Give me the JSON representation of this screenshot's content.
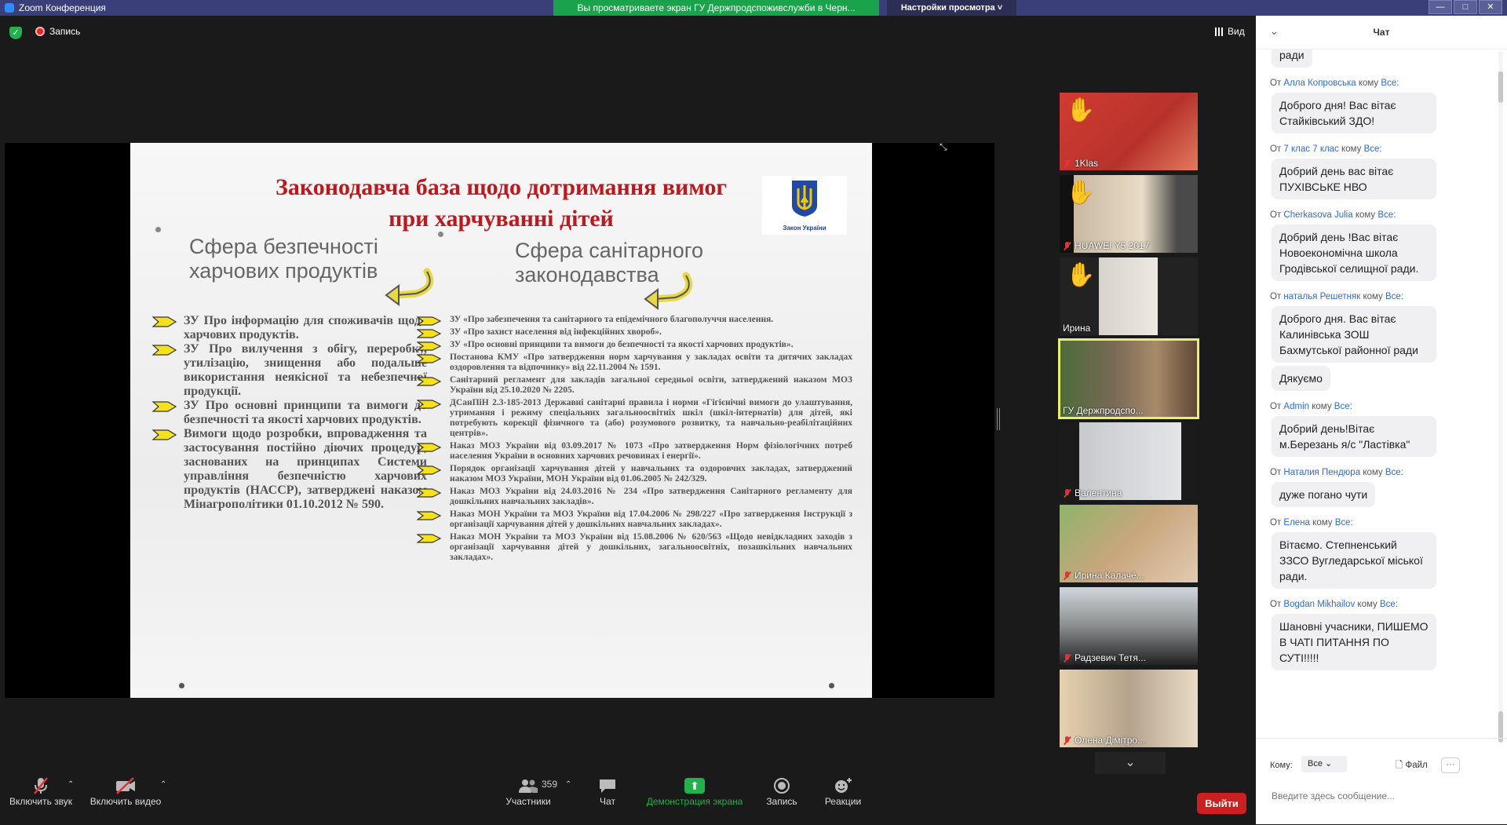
{
  "window": {
    "app_title": "Zoom Конференция",
    "share_banner": "Вы просматриваете экран ГУ Держпродспоживслужби в Черн...",
    "view_settings": "Настройки просмотра",
    "controls": [
      "—",
      "□",
      "✕"
    ]
  },
  "meeting_top": {
    "recording_label": "Запись",
    "view_label": "Вид"
  },
  "slide": {
    "title_line1": "Законодавча база щодо дотримання вимог",
    "title_line2": "при харчуванні дітей",
    "emblem_caption": "Закон України",
    "sphere_left": "Сфера безпечності харчових продуктів",
    "sphere_right": "Сфера санітарного законодавства",
    "left_items": [
      "ЗУ Про інформацію для споживачів щодо харчових продуктів.",
      "ЗУ Про вилучення з обігу, переробку, утилізацію, знищення або подальше використання неякісної та небезпечної продукції.",
      "ЗУ Про основні принципи та вимоги до безпечності та якості харчових продуктів.",
      "Вимоги щодо розробки, впровадження та застосування постійно діючих процедур, заснованих на принципах Системи управління безпечністю харчових продуктів (НАССР), затверджені наказом Мінагрополітики 01.10.2012 № 590."
    ],
    "right_items": [
      "ЗУ «Про забезпечення та санітарного та епідемічного благополуччя населення.",
      "ЗУ «Про захист населення від інфекційних хвороб».",
      "ЗУ «Про основні принципи та вимоги до безпечності та якості харчових продуктів».",
      "Постанова КМУ «Про затвердження норм харчування у закладах освіти та дитячих закладах оздоровлення та відпочинку» від 22.11.2004 № 1591.",
      "Санітарний регламент для закладів загальної середньої освіти, затверджений наказом МОЗ України від 25.10.2020 № 2205.",
      "ДСанПіН 2.3-185-2013 Державні санітарні правила і норми «Гігієнічні вимоги до улаштування, утримання і режиму спеціальних загальноосвітніх шкіл (шкіл-інтернатів) для дітей, які потребують корекції фізичного та (або) розумового розвитку, та навчально-реабілітаційних центрів».",
      "Наказ МОЗ України від 03.09.2017 № 1073 «Про затвердження Норм фізіологічних потреб населення України в основних харчових речовинах і енергії».",
      "Порядок організації харчування дітей у навчальних та оздоровчих закладах, затверджений наказом МОЗ України, МОН України від 01.06.2005 № 242/329.",
      "Наказ МОЗ України від 24.03.2016 № 234 «Про затвердження Санітарного регламенту для дошкільних навчальних закладів».",
      "Наказ МОН України та МОЗ України від 17.04.2006 № 298/227 «Про затвердження Інструкції з організації харчування дітей у дошкільних навчальних закладах».",
      "Наказ МОН України та МОЗ України від 15.08.2006 № 620/563 «Щодо невідкладних заходів з організації харчування дітей у дошкільних, загальноосвітніх, позашкільних навчальних закладах»."
    ]
  },
  "participants": [
    {
      "name": "1Klas",
      "muted": true,
      "hand": true
    },
    {
      "name": "HUAWEI Y5 2017",
      "muted": true,
      "hand": true
    },
    {
      "name": "Ирина",
      "muted": false,
      "hand": true
    },
    {
      "name": "ГУ Держпродспо...",
      "muted": false,
      "hand": false,
      "active": true
    },
    {
      "name": "Валентина",
      "muted": true,
      "hand": false
    },
    {
      "name": "Ирина Калачё...",
      "muted": true,
      "hand": false
    },
    {
      "name": "Радзевич Тетя...",
      "muted": true,
      "hand": false
    },
    {
      "name": "Олена Дімітро...",
      "muted": true,
      "hand": false
    }
  ],
  "toolbar": {
    "audio": "Включить звук",
    "video": "Включить видео",
    "participants": "Участники",
    "participants_count": "359",
    "chat": "Чат",
    "share": "Демонстрация экрана",
    "record": "Запись",
    "reactions": "Реакции",
    "leave": "Выйти"
  },
  "chat": {
    "title": "Чат",
    "top_fragment": "ради",
    "messages": [
      {
        "prefix": "От",
        "sender": "Алла Копровська",
        "mid": "кому",
        "to": "Все:",
        "texts": [
          "Доброго дня! Вас вітає Стайківський ЗДО!"
        ]
      },
      {
        "prefix": "От",
        "sender": "7 клас 7 клас",
        "mid": "кому",
        "to": "Все:",
        "texts": [
          "Добрий день вас вітає ПУХІВСЬКЕ НВО"
        ]
      },
      {
        "prefix": "От",
        "sender": "Cherkasova Julia",
        "mid": "кому",
        "to": "Все:",
        "texts": [
          "Добрий день !Вас вітає Новоекономічна школа Гродівської селищної ради."
        ]
      },
      {
        "prefix": "От",
        "sender": "наталья Решетняк",
        "mid": "кому",
        "to": "Все:",
        "texts": [
          "Доброго дня. Вас вітає Калинівська ЗОШ Бахмутської районної ради",
          "Дякуємо"
        ]
      },
      {
        "prefix": "От",
        "sender": "Admin",
        "mid": "кому",
        "to": "Все:",
        "texts": [
          "Добрий день!Вітає м.Березань я/с \"Ластівка\""
        ]
      },
      {
        "prefix": "От",
        "sender": "Наталия Пендюра",
        "mid": "кому",
        "to": "Все:",
        "texts": [
          "дуже погано чути"
        ]
      },
      {
        "prefix": "От",
        "sender": "Елена",
        "mid": "кому",
        "to": "Все:",
        "texts": [
          "Вітаємо. Степненський ЗЗСО Вугледарської міської ради."
        ]
      },
      {
        "prefix": "От",
        "sender": "Bogdan Mikhailov",
        "mid": "кому",
        "to": "Все:",
        "texts": [
          "Шановні учасники, ПИШЕМО В ЧАТІ ПИТАННЯ ПО СУТІ!!!!!"
        ]
      }
    ],
    "to_label": "Кому:",
    "to_value": "Все",
    "file_label": "Файл",
    "more_label": "···",
    "input_placeholder": "Введите здесь сообщение..."
  }
}
